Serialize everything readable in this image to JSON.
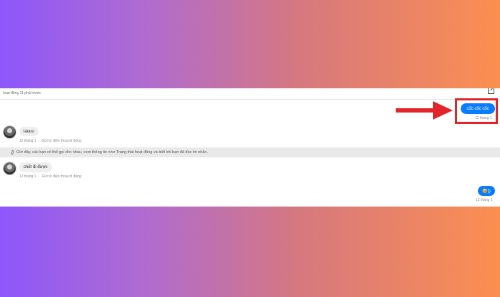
{
  "header": {
    "status_text": "hoạt động 11 phút trước"
  },
  "messages": {
    "outgoing_1": {
      "text": "cốc cốc cốc",
      "date": "12 tháng 1"
    },
    "incoming_1": {
      "text": "lauuu",
      "date": "12 tháng 1",
      "via": "Gửi từ điện thoại di động"
    },
    "notice": "Giờ đây, các bạn có thể gọi cho nhau, xem thông tin như Trạng thái hoạt động và biết khi bạn đã đọc tin nhắn.",
    "incoming_2": {
      "text": "chết đi được",
      "date": "12 tháng 1",
      "via": "Gửi từ điện thoại di động"
    },
    "outgoing_2": {
      "text": "😄))",
      "date": "12 tháng 1"
    }
  },
  "colors": {
    "bubble_outgoing": "#0a7cff",
    "bubble_incoming": "#efefef",
    "annotation_red": "#e2252b",
    "bg_gradient_left": "#8d57fb",
    "bg_gradient_right": "#fb8f50"
  },
  "icons": {
    "expand": "expand-icon",
    "phone": "phone-icon",
    "avatar": "avatar",
    "arrow": "arrow-right-annotation"
  }
}
